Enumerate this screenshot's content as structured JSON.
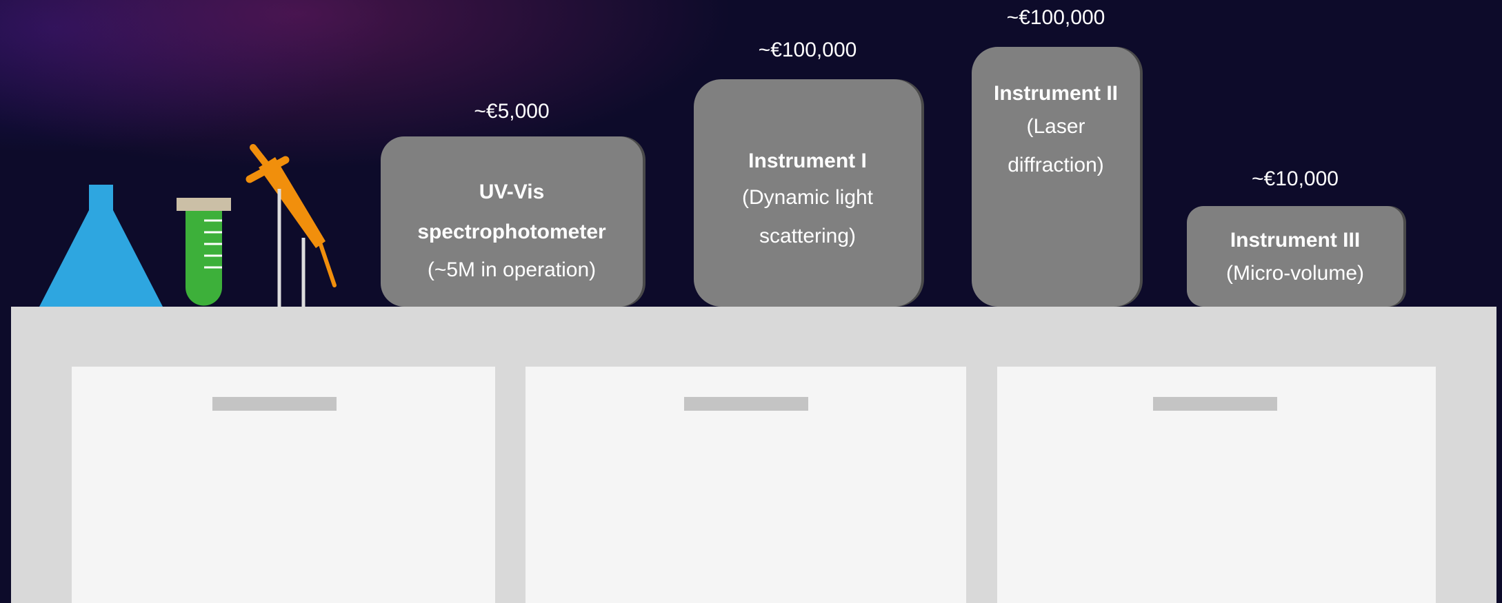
{
  "colors": {
    "background": "#0d0b2a",
    "instrument": "#808080",
    "bench": "#d9d9d9",
    "cabinet": "#f5f5f5",
    "flask": "#2ea6e0",
    "test_tube": "#3db03a",
    "pipette": "#f18f0c"
  },
  "instruments": [
    {
      "price": "~€5,000",
      "title": "UV-Vis spectrophotometer",
      "subtitle": "(~5M in operation)"
    },
    {
      "price": "~€100,000",
      "title": "Instrument I",
      "subtitle": "(Dynamic light scattering)"
    },
    {
      "price": "~€100,000",
      "title": "Instrument II",
      "subtitle": "(Laser diffraction)"
    },
    {
      "price": "~€10,000",
      "title": "Instrument III",
      "subtitle": "(Micro-volume)"
    }
  ],
  "glassware": [
    "flask-icon",
    "test-tube-icon",
    "pipette-icon"
  ]
}
